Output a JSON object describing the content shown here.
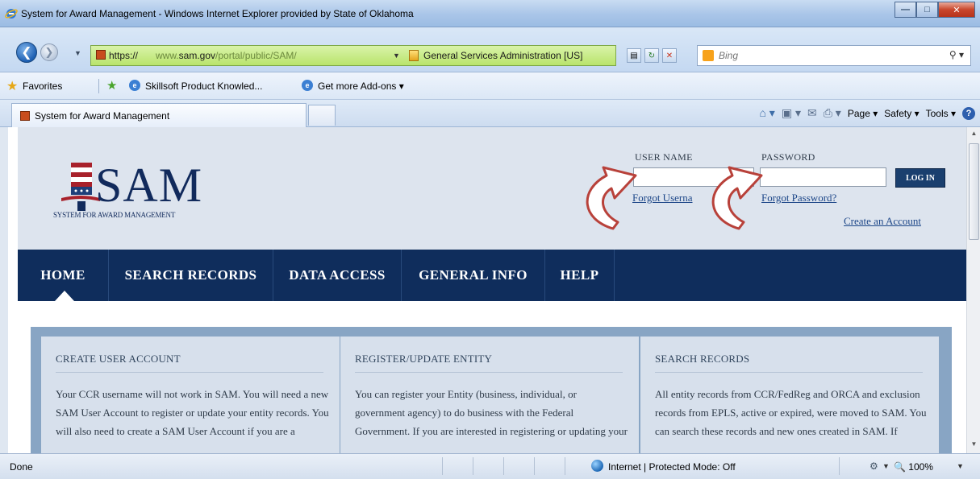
{
  "window": {
    "title": "System for Award Management - Windows Internet Explorer provided by State of Oklahoma"
  },
  "address": {
    "protocol": "https://",
    "url_prefix": "www.",
    "url_domain": "sam.gov",
    "url_path": "/portal/public/SAM/",
    "certificate_label": "General Services Administration [US]"
  },
  "search": {
    "placeholder": "Bing"
  },
  "favorites_bar": {
    "favorites_label": "Favorites",
    "links": [
      "Skillsoft Product Knowled...",
      "Get more Add-ons ▾"
    ]
  },
  "tab": {
    "label": "System for Award Management"
  },
  "command_bar": {
    "page_label": "Page ▾",
    "safety_label": "Safety ▾",
    "tools_label": "Tools ▾"
  },
  "logo": {
    "word": "SAM",
    "tagline": "SYSTEM FOR AWARD MANAGEMENT"
  },
  "login": {
    "username_label": "USER NAME",
    "password_label": "PASSWORD",
    "login_button": "LOG IN",
    "forgot_username": "Forgot Userna",
    "forgot_password": "Forgot Password?",
    "create_account": "Create an Account"
  },
  "nav": {
    "items": [
      "HOME",
      "SEARCH RECORDS",
      "DATA ACCESS",
      "GENERAL INFO",
      "HELP"
    ]
  },
  "cards": [
    {
      "title": "CREATE USER ACCOUNT",
      "body": "Your CCR username will not work in SAM. You will need a new SAM User Account to register or update your entity records. You will also need to create a SAM User Account if you are a"
    },
    {
      "title": "REGISTER/UPDATE ENTITY",
      "body": "You can register your Entity (business, individual, or government agency) to do business with the Federal Government. If you are interested in registering or updating your"
    },
    {
      "title": "SEARCH RECORDS",
      "body": "All entity records from CCR/FedReg and ORCA and exclusion records from EPLS, active or expired, were moved to SAM. You can search these records and new ones created in SAM. If"
    }
  ],
  "status_bar": {
    "status": "Done",
    "zone": "Internet | Protected Mode: Off",
    "zoom": "100%"
  },
  "colors": {
    "nav_background": "#0f2d5c",
    "header_background": "#dde4ee",
    "address_bar_green": "#b9e46c",
    "link_blue": "#1c4688"
  }
}
